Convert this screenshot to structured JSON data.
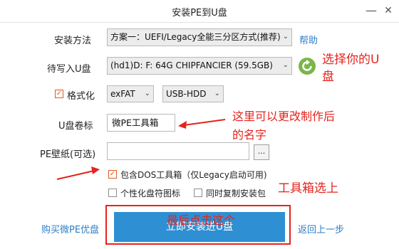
{
  "window": {
    "title": "安装PE到U盘",
    "min_icon": "minimize-icon",
    "close_icon": "close-icon"
  },
  "method": {
    "label": "安装方法",
    "value": "方案一：UEFI/Legacy全能三分区方式(推荐)",
    "help_link": "帮助"
  },
  "target": {
    "label": "待写入U盘",
    "value": "(hd1)D: F: 64G CHIPFANCIER (59.5GB)",
    "refresh_icon": "refresh-icon"
  },
  "format": {
    "label": "格式化",
    "checked": true,
    "fs_value": "exFAT",
    "mode_value": "USB-HDD"
  },
  "volume": {
    "label": "U盘卷标",
    "value": "微PE工具箱"
  },
  "wallpaper": {
    "label": "PE壁纸(可选)",
    "value": "",
    "browse_label": "..."
  },
  "options": {
    "dos_tools": {
      "label": "包含DOS工具箱（仅Legacy启动可用)",
      "checked": true
    },
    "personalize": {
      "label": "个性化盘符图标",
      "checked": false
    },
    "copy_pkg": {
      "label": "同时复制安装包",
      "checked": false
    }
  },
  "footer": {
    "buy_link": "购买微PE优盘",
    "install_button": "立即安装进U盘",
    "back_link": "返回上一步"
  },
  "annotations": {
    "select_disk": "选择你的U\n盘",
    "rename_line1": "这里可以更改制作后",
    "rename_line2": "的名字",
    "toolbox": "工具箱选上",
    "click_last": "最后点击这个"
  },
  "colors": {
    "accent": "#2f8fd3",
    "annotation": "#e5231d",
    "check": "#e25a1c"
  }
}
